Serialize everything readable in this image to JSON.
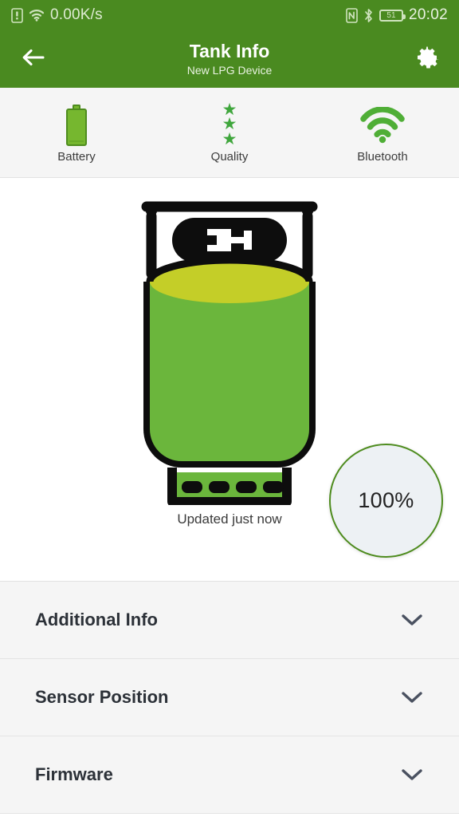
{
  "statusbar": {
    "network_speed": "0.00K/s",
    "battery_level": "51",
    "time": "20:02",
    "icons": [
      "sim-card-icon",
      "wifi-icon",
      "nfc-icon",
      "bluetooth-icon",
      "battery-icon"
    ]
  },
  "appbar": {
    "back_icon": "arrow-left-icon",
    "title": "Tank Info",
    "subtitle": "New LPG Device",
    "settings_icon": "gear-icon"
  },
  "indicators": [
    {
      "label": "Battery",
      "icon": "battery-icon"
    },
    {
      "label": "Quality",
      "icon": "stars-icon",
      "stars": 3
    },
    {
      "label": "Bluetooth",
      "icon": "signal-waves-icon"
    }
  ],
  "tank": {
    "level_percent": "100%",
    "fill_fraction": 1.0,
    "updated_text": "Updated just now",
    "body_color": "#6BB63C",
    "surface_color": "#C4CE28",
    "outline_color": "#0D0D0D",
    "badge_bg": "#EDF1F4",
    "badge_border": "#4E8C1E"
  },
  "sections": [
    {
      "label": "Additional Info",
      "chevron": "chevron-down-icon"
    },
    {
      "label": "Sensor Position",
      "chevron": "chevron-down-icon"
    },
    {
      "label": "Firmware",
      "chevron": "chevron-down-icon"
    }
  ],
  "theme": {
    "primary": "#4A8A20",
    "surface": "#F5F5F5",
    "text": "#2C3138"
  }
}
